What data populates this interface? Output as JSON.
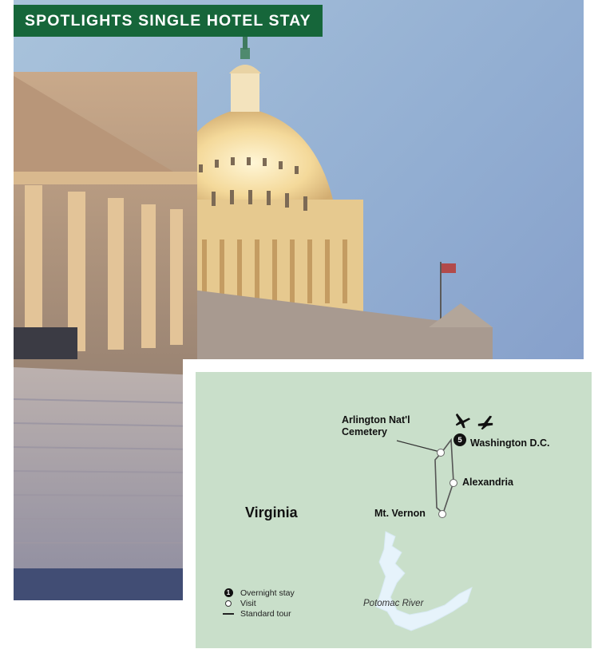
{
  "banner": {
    "text": "SPOTLIGHTS SINGLE HOTEL STAY"
  },
  "photo": {
    "subject": "us-capitol-building-dome-at-dusk"
  },
  "map": {
    "state_label": "Virginia",
    "overnight_stay": {
      "label": "Washington D.C.",
      "nights": "5"
    },
    "visits": [
      {
        "label": "Arlington Nat'l\nCemetery"
      },
      {
        "label": "Alexandria"
      },
      {
        "label": "Mt. Vernon"
      }
    ],
    "river_label": "Potomac River",
    "legend": [
      {
        "icon": "overnight-stay-icon",
        "label": "Overnight stay"
      },
      {
        "icon": "visit-icon",
        "label": "Visit"
      },
      {
        "icon": "standard-tour-line-icon",
        "label": "Standard tour"
      }
    ],
    "icons": [
      "airplane-arrival-icon",
      "airplane-departure-icon"
    ]
  },
  "colors": {
    "banner": "#16663a",
    "map_land": "#c9dfca",
    "river": "#e6f3fb"
  }
}
